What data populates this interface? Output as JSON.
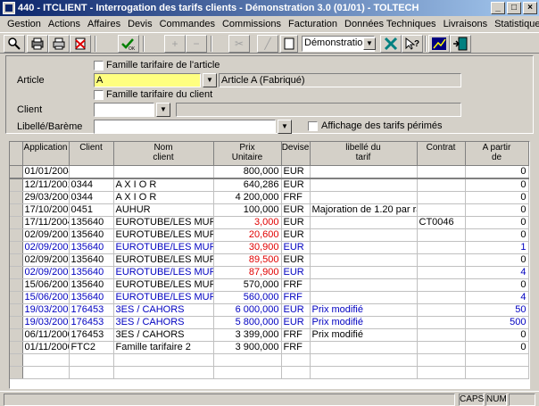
{
  "window": {
    "title": "440 - ITCLIENT - Interrogation des tarifs clients - Démonstration 3.0 (01/01) - TOLTECH"
  },
  "menu": [
    "Gestion",
    "Actions",
    "Affaires",
    "Devis",
    "Commandes",
    "Commissions",
    "Facturation",
    "Données Techniques",
    "Livraisons",
    "Statistiques"
  ],
  "toolbar": {
    "company": "Démonstration 3.0"
  },
  "form": {
    "famille_article_label": "Famille tarifaire de l'article",
    "article_label": "Article",
    "article_code": "A",
    "article_desc": "Article A (Fabriqué)",
    "famille_client_label": "Famille tarifaire du client",
    "client_label": "Client",
    "client_code": "",
    "client_desc": "",
    "libelle_label": "Libellé/Barème",
    "libelle_value": "",
    "perimes_label": "Affichage des tarifs périmés"
  },
  "table": {
    "headers": [
      "Application",
      "Client",
      "Nom\nclient",
      "Prix\nUnitaire",
      "Devise",
      "libellé du\ntarif",
      "Contrat",
      "A partir\nde"
    ],
    "rows": [
      {
        "app": "01/01/2004",
        "client": "",
        "nom": "",
        "prix": "800,000",
        "devise": "EUR",
        "libelle": "",
        "contrat": "",
        "apartir": "0",
        "style": "first"
      },
      {
        "app": "12/11/2001",
        "client": "0344",
        "nom": "A X I O R",
        "prix": "640,286",
        "devise": "EUR",
        "libelle": "",
        "contrat": "",
        "apartir": "0",
        "style": ""
      },
      {
        "app": "29/03/2000",
        "client": "0344",
        "nom": "A X I O R",
        "prix": "4 200,000",
        "devise": "FRF",
        "libelle": "",
        "contrat": "",
        "apartir": "0",
        "style": ""
      },
      {
        "app": "17/10/2001",
        "client": "0451",
        "nom": "AUHUR",
        "prix": "100,000",
        "devise": "EUR",
        "libelle": "Majoration de 1.20 par rapport",
        "contrat": "",
        "apartir": "0",
        "style": ""
      },
      {
        "app": "17/11/2004",
        "client": "135640",
        "nom": "EUROTUBE/LES MUREAU",
        "prix": "3,000",
        "devise": "EUR",
        "libelle": "",
        "contrat": "CT0046",
        "apartir": "0",
        "style": "redprice"
      },
      {
        "app": "02/09/2002",
        "client": "135640",
        "nom": "EUROTUBE/LES MUREAU",
        "prix": "20,600",
        "devise": "EUR",
        "libelle": "",
        "contrat": "",
        "apartir": "0",
        "style": "redprice"
      },
      {
        "app": "02/09/2002",
        "client": "135640",
        "nom": "EUROTUBE/LES MUREAU",
        "prix": "30,900",
        "devise": "EUR",
        "libelle": "",
        "contrat": "",
        "apartir": "1",
        "style": "blue redprice"
      },
      {
        "app": "02/09/2002",
        "client": "135640",
        "nom": "EUROTUBE/LES MUREAU",
        "prix": "89,500",
        "devise": "EUR",
        "libelle": "",
        "contrat": "",
        "apartir": "0",
        "style": "redprice"
      },
      {
        "app": "02/09/2002",
        "client": "135640",
        "nom": "EUROTUBE/LES MUREAU",
        "prix": "87,900",
        "devise": "EUR",
        "libelle": "",
        "contrat": "",
        "apartir": "4",
        "style": "blue redprice"
      },
      {
        "app": "15/06/2001",
        "client": "135640",
        "nom": "EUROTUBE/LES MUREAU",
        "prix": "570,000",
        "devise": "FRF",
        "libelle": "",
        "contrat": "",
        "apartir": "0",
        "style": ""
      },
      {
        "app": "15/06/2001",
        "client": "135640",
        "nom": "EUROTUBE/LES MUREAU",
        "prix": "560,000",
        "devise": "FRF",
        "libelle": "",
        "contrat": "",
        "apartir": "4",
        "style": "blue"
      },
      {
        "app": "19/03/2002",
        "client": "176453",
        "nom": "3ES / CAHORS",
        "prix": "6 000,000",
        "devise": "EUR",
        "libelle": "Prix modifié",
        "contrat": "",
        "apartir": "50",
        "style": "blue"
      },
      {
        "app": "19/03/2002",
        "client": "176453",
        "nom": "3ES / CAHORS",
        "prix": "5 800,000",
        "devise": "EUR",
        "libelle": "Prix modifié",
        "contrat": "",
        "apartir": "500",
        "style": "blue"
      },
      {
        "app": "06/11/2000",
        "client": "176453",
        "nom": "3ES / CAHORS",
        "prix": "3 399,000",
        "devise": "FRF",
        "libelle": "Prix modifié",
        "contrat": "",
        "apartir": "0",
        "style": ""
      },
      {
        "app": "01/11/2000",
        "client": "FTC2",
        "nom": "Famille tarifaire 2",
        "prix": "3 900,000",
        "devise": "FRF",
        "libelle": "",
        "contrat": "",
        "apartir": "0",
        "style": ""
      }
    ],
    "empty_rows": 2
  },
  "status": {
    "caps": "CAPS",
    "num": "NUM"
  },
  "colors": {
    "title_start": "#0a246a",
    "title_end": "#a6caf0",
    "blue_row": "#0000c0",
    "red_price": "#e00000",
    "highlight": "#ffff80"
  }
}
